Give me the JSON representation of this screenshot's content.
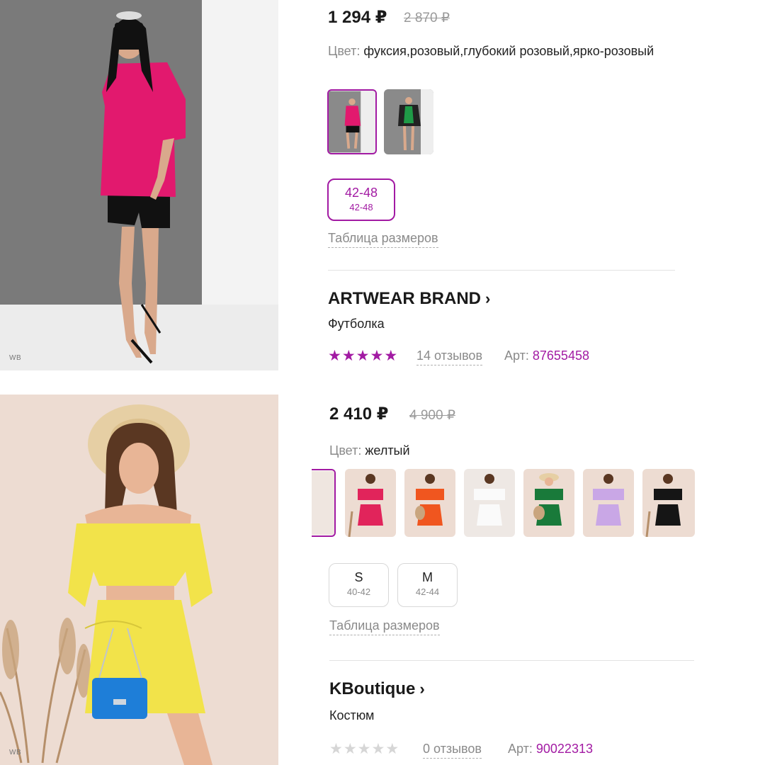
{
  "watermark": "WB",
  "accent_color": "#a21aa3",
  "products": [
    {
      "price": "1 294 ₽",
      "old_price": "2 870 ₽",
      "color_label": "Цвет:",
      "color_value": "фуксия,розовый,глубокий розовый,ярко-розовый",
      "swatches": [
        "fuchsia-tshirt",
        "green-tshirt"
      ],
      "selected_swatch": 0,
      "sizes": [
        {
          "label": "42-48",
          "sub": "42-48",
          "selected": true
        }
      ],
      "size_table": "Таблица размеров",
      "brand": "ARTWEAR BRAND",
      "product_type": "Футболка",
      "rating": 5,
      "reviews": "14 отзывов",
      "art_label": "Арт:",
      "art_number": "87655458"
    },
    {
      "price": "2 410 ₽",
      "old_price": "4 900 ₽",
      "color_label": "Цвет:",
      "color_value": "желтый",
      "swatches": [
        "yellow-suit",
        "raspberry-suit",
        "orange-suit",
        "white-suit",
        "green-suit",
        "lilac-suit",
        "black-suit"
      ],
      "selected_swatch": 0,
      "sizes": [
        {
          "label": "S",
          "sub": "40-42",
          "selected": false
        },
        {
          "label": "M",
          "sub": "42-44",
          "selected": false
        }
      ],
      "size_table": "Таблица размеров",
      "brand": "KBoutique",
      "product_type": "Костюм",
      "rating": 0,
      "reviews": "0 отзывов",
      "art_label": "Арт:",
      "art_number": "90022313"
    }
  ]
}
